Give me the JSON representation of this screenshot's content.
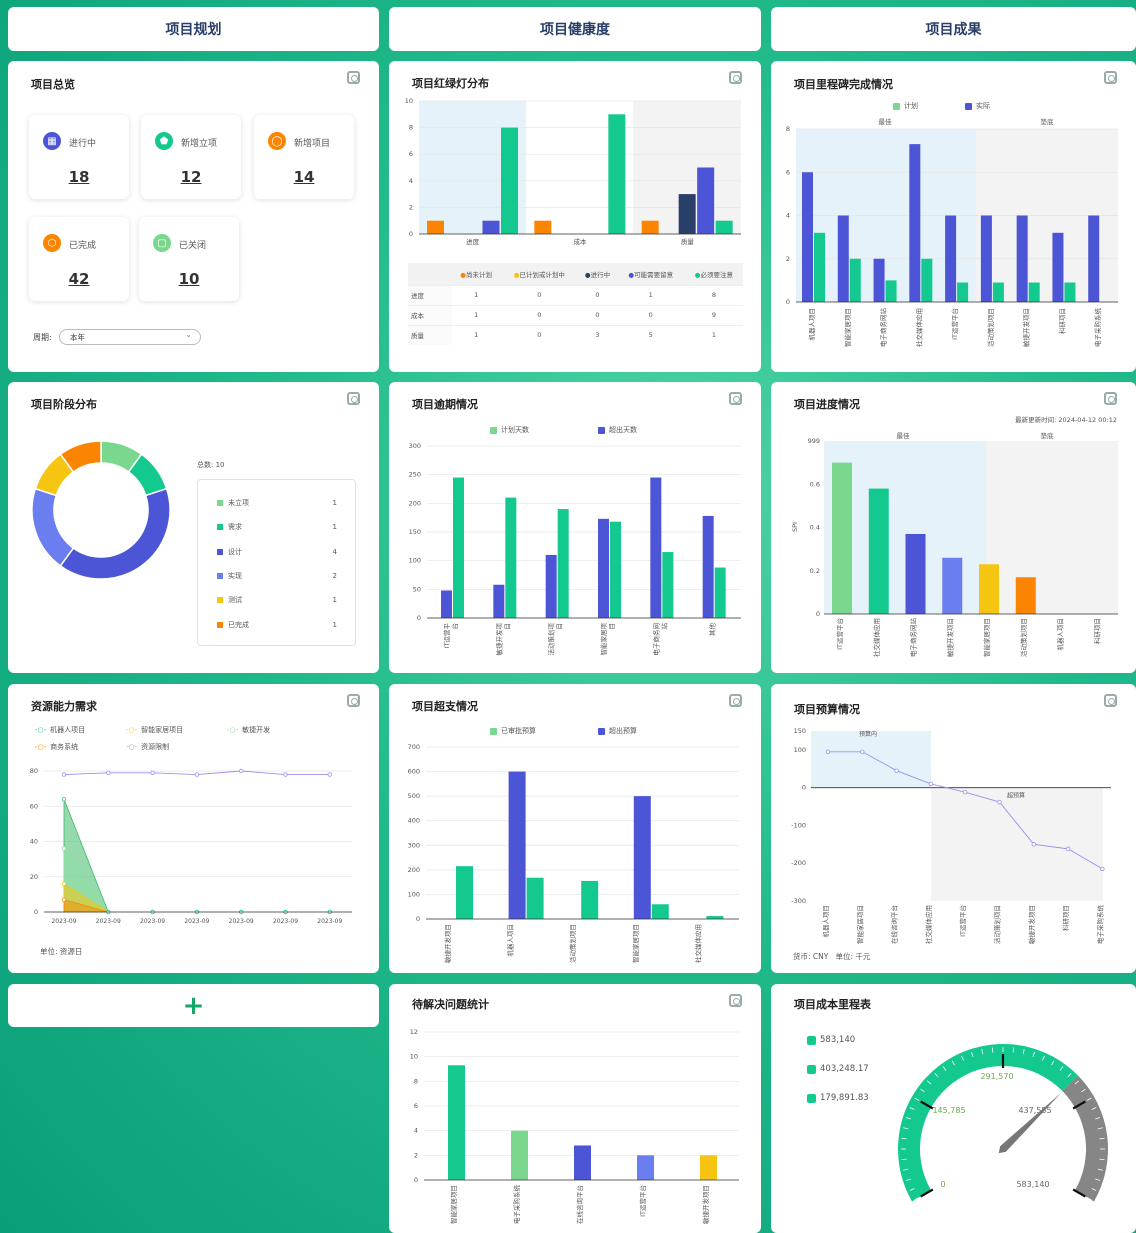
{
  "columns": [
    "项目规划",
    "项目健康度",
    "项目成果"
  ],
  "overview": {
    "title": "项目总览",
    "stats": [
      {
        "label": "进行中",
        "value": "18"
      },
      {
        "label": "新增立项",
        "value": "12"
      },
      {
        "label": "新增项目",
        "value": "14"
      },
      {
        "label": "已完成",
        "value": "42"
      },
      {
        "label": "已关闭",
        "value": "10"
      }
    ],
    "period_label": "周期:",
    "period_value": "本年"
  },
  "traffic": {
    "title": "项目红绿灯分布",
    "table_headers": [
      "尚未计划",
      "已计划或计划中",
      "进行中",
      "可能需要留意",
      "必须要注意"
    ],
    "rows": [
      {
        "name": "进度",
        "values": [
          "1",
          "0",
          "0",
          "1",
          "8"
        ]
      },
      {
        "name": "成本",
        "values": [
          "1",
          "0",
          "0",
          "0",
          "9"
        ]
      },
      {
        "name": "质量",
        "values": [
          "1",
          "0",
          "3",
          "5",
          "1"
        ]
      }
    ]
  },
  "milestone": {
    "title": "项目里程碑完成情况",
    "legend": [
      "计划",
      "实际"
    ],
    "zones": [
      "最佳",
      "垫底"
    ]
  },
  "stage": {
    "title": "项目阶段分布",
    "total_label": "总数:",
    "total": "10",
    "items": [
      {
        "name": "未立项",
        "value": "1",
        "color": "#7ad88e"
      },
      {
        "name": "需求",
        "value": "1",
        "color": "#14c98f"
      },
      {
        "name": "设计",
        "value": "4",
        "color": "#4b55d6"
      },
      {
        "name": "实现",
        "value": "2",
        "color": "#6b7ef0"
      },
      {
        "name": "测试",
        "value": "1",
        "color": "#f6c511"
      },
      {
        "name": "已完成",
        "value": "1",
        "color": "#fb8500"
      }
    ]
  },
  "overdue": {
    "title": "项目逾期情况",
    "legend": [
      "计划天数",
      "超出天数"
    ]
  },
  "progress": {
    "title": "项目进度情况",
    "update_label": "最新更新时间:",
    "update_time": "2024-04-12 00:12",
    "ylabel": "SPI",
    "zones": [
      "最佳",
      "垫底"
    ]
  },
  "resource": {
    "title": "资源能力需求",
    "legend": [
      "机器人项目",
      "智能家居项目",
      "敏捷开发",
      "商务系统",
      "资源限制"
    ],
    "unit": "单位: 资源日"
  },
  "overbudget": {
    "title": "项目超支情况",
    "legend": [
      "已审批预算",
      "超出预算"
    ]
  },
  "budget": {
    "title": "项目预算情况",
    "zones": [
      "预算内",
      "超预算"
    ],
    "currency_label": "货币:",
    "currency": "CNY",
    "unit_label": "单位:",
    "unit": "千元"
  },
  "issues": {
    "title": "待解决问题统计"
  },
  "cost": {
    "title": "项目成本里程表",
    "legend": [
      "583,140",
      "403,248.17",
      "179,891.83"
    ],
    "gauge_labels": [
      "0",
      "145,785",
      "291,570",
      "437,555",
      "583,140"
    ]
  },
  "add_button": "+",
  "colors": {
    "green": "#14c98f",
    "blue": "#4b55d6",
    "orange": "#fb8500",
    "yellow": "#f6c511",
    "light_green": "#7ad88e"
  },
  "chart_data": [
    {
      "id": "traffic",
      "type": "bar",
      "title": "项目红绿灯分布",
      "categories": [
        "进度",
        "成本",
        "质量"
      ],
      "ylim": [
        0,
        10
      ],
      "series": [
        {
          "name": "尚未计划",
          "values": [
            1,
            1,
            1
          ]
        },
        {
          "name": "已计划或计划中",
          "values": [
            0,
            0,
            0
          ]
        },
        {
          "name": "进行中",
          "values": [
            0,
            0,
            3
          ]
        },
        {
          "name": "可能需要留意",
          "values": [
            1,
            0,
            5
          ]
        },
        {
          "name": "必须要注意",
          "values": [
            8,
            9,
            1
          ]
        }
      ]
    },
    {
      "id": "milestone",
      "type": "bar",
      "title": "项目里程碑完成情况",
      "categories": [
        "机器人项目",
        "智能家居项目",
        "电子商务网站",
        "社交媒体应用",
        "IT运营平台",
        "活动策划项目",
        "敏捷开发项目",
        "科研项目",
        "电子采购系统"
      ],
      "ylim": [
        0,
        8
      ],
      "series": [
        {
          "name": "计划",
          "values": [
            3.2,
            2,
            1,
            2,
            0.9,
            0.9,
            0.9,
            0.9,
            0
          ]
        },
        {
          "name": "实际",
          "values": [
            6,
            4,
            2,
            7.3,
            4,
            4,
            4,
            3.2,
            4
          ]
        }
      ]
    },
    {
      "id": "stage",
      "type": "pie",
      "title": "项目阶段分布",
      "categories": [
        "未立项",
        "需求",
        "设计",
        "实现",
        "测试",
        "已完成"
      ],
      "values": [
        1,
        1,
        4,
        2,
        1,
        1
      ]
    },
    {
      "id": "overdue",
      "type": "bar",
      "title": "项目逾期情况",
      "categories": [
        "IT运营平台",
        "敏捷开发项目",
        "活动策划项目",
        "智能家居项目",
        "电子商务网站",
        "其他"
      ],
      "ylim": [
        0,
        300
      ],
      "series": [
        {
          "name": "计划天数",
          "values": [
            245,
            210,
            190,
            168,
            115,
            88
          ]
        },
        {
          "name": "超出天数",
          "values": [
            48,
            58,
            110,
            173,
            245,
            178
          ]
        }
      ]
    },
    {
      "id": "progress",
      "type": "bar",
      "title": "项目进度情况",
      "categories": [
        "IT运营平台",
        "社交媒体应用",
        "电子商务网站",
        "敏捷开发项目",
        "智能家居项目",
        "活动策划项目",
        "机器人项目",
        "科研项目"
      ],
      "ylabel": "SPI",
      "ylim": [
        0,
        0.8
      ],
      "values": [
        0.7,
        0.58,
        0.37,
        0.26,
        0.23,
        0.17,
        0,
        0
      ]
    },
    {
      "id": "resource",
      "type": "area",
      "title": "资源能力需求",
      "x": [
        "2023-09",
        "2023-09",
        "2023-09",
        "2023-09",
        "2023-09",
        "2023-09",
        "2023-09"
      ],
      "ylim": [
        0,
        80
      ],
      "series": [
        {
          "name": "机器人项目",
          "values": [
            64,
            0,
            0,
            0,
            0,
            0,
            0
          ]
        },
        {
          "name": "智能家居项目",
          "values": [
            7,
            0,
            0,
            0,
            0,
            0,
            0
          ]
        },
        {
          "name": "敏捷开发",
          "values": [
            36,
            0,
            0,
            0,
            0,
            0,
            0
          ]
        },
        {
          "name": "商务系统",
          "values": [
            16,
            0,
            0,
            0,
            0,
            0,
            0
          ]
        },
        {
          "name": "资源限制",
          "values": [
            78,
            79,
            79,
            78,
            80,
            78,
            78
          ]
        }
      ]
    },
    {
      "id": "overbudget",
      "type": "bar",
      "title": "项目超支情况",
      "categories": [
        "敏捷开发项目",
        "机器人项目",
        "活动策划项目",
        "智能家居项目",
        "社交媒体应用"
      ],
      "ylim": [
        0,
        700
      ],
      "series": [
        {
          "name": "已审批预算",
          "values": [
            215,
            168,
            155,
            60,
            12
          ]
        },
        {
          "name": "超出预算",
          "values": [
            0,
            600,
            0,
            500,
            0
          ]
        }
      ]
    },
    {
      "id": "budget",
      "type": "line",
      "title": "项目预算情况",
      "categories": [
        "机器人项目",
        "智能家居项目",
        "在线咨询平台",
        "社交媒体应用",
        "IT运营平台",
        "活动策划项目",
        "敏捷开发项目",
        "科研项目",
        "电子采购系统"
      ],
      "ylim": [
        -300,
        150
      ],
      "values": [
        95,
        95,
        45,
        10,
        -12,
        -38,
        -150,
        -162,
        -215
      ]
    },
    {
      "id": "issues",
      "type": "bar",
      "title": "待解决问题统计",
      "categories": [
        "智能家居项目",
        "电子采购系统",
        "在线咨询平台",
        "IT运营平台",
        "敏捷开发项目"
      ],
      "ylim": [
        0,
        12
      ],
      "values": [
        9.3,
        4,
        2.8,
        2,
        2
      ]
    },
    {
      "id": "cost",
      "type": "gauge",
      "title": "项目成本里程表",
      "min": 0,
      "max": 583140,
      "value": 403248.17,
      "marks": [
        0,
        145785,
        291570,
        437555,
        583140
      ]
    }
  ]
}
